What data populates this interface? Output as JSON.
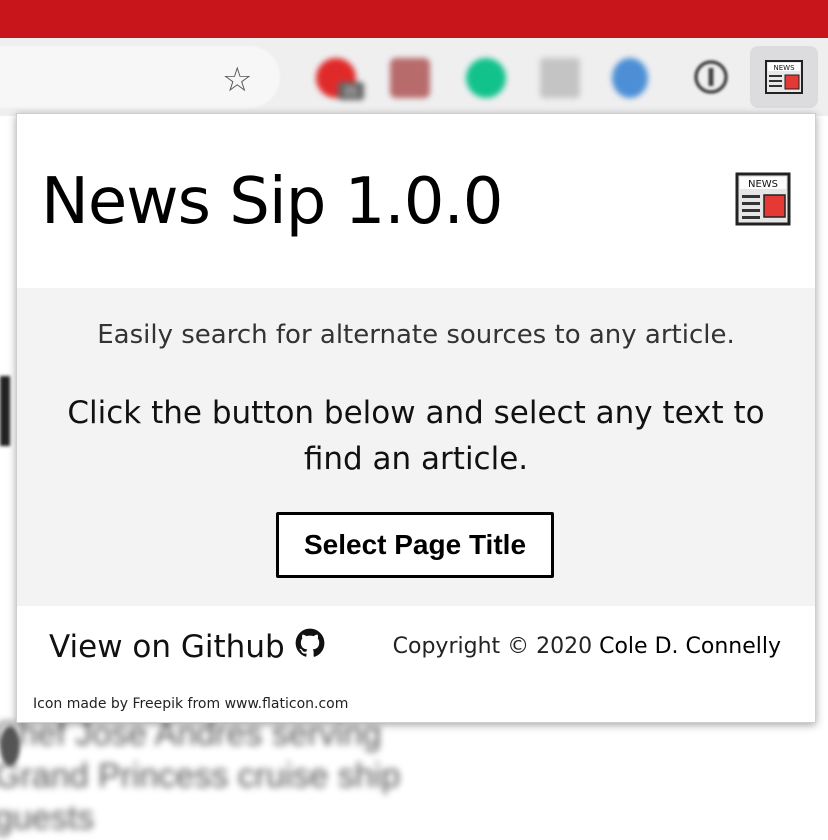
{
  "popup": {
    "title": "News Sip 1.0.0",
    "subtitle": "Easily search for alternate sources to any article.",
    "instructions": "Click the button below and select any text to find an article.",
    "button_label": "Select Page Title",
    "github_label": "View on Github",
    "copyright_prefix": "Copyright © 2020 ",
    "copyright_author": "Cole D. Connelly",
    "credit": "Icon made by Freepik from www.flaticon.com"
  },
  "background": {
    "headline_lines": [
      "Chef Jose Andres serving",
      "Grand Princess cruise ship",
      "guests"
    ]
  },
  "toolbar": {
    "extension_badge": "21",
    "icons": [
      "star-icon",
      "extension-icon",
      "grammarly-icon",
      "news-sip-icon",
      "github-icon"
    ]
  },
  "colors": {
    "topbar": "#c8151b",
    "news_icon_red": "#e53935",
    "button_border": "#000000"
  }
}
